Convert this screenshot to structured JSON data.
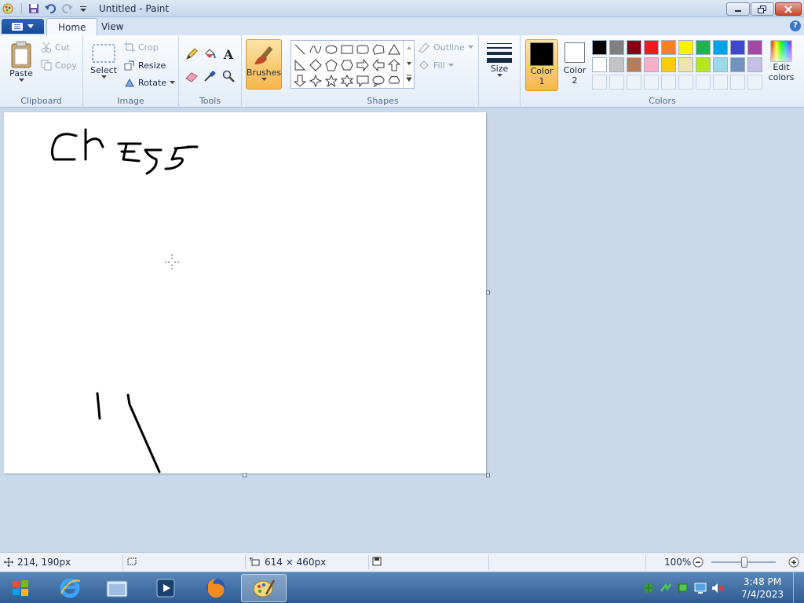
{
  "window": {
    "title": "Untitled - Paint"
  },
  "tabs": {
    "file_menu": "",
    "home": "Home",
    "view": "View"
  },
  "clipboard": {
    "paste": "Paste",
    "cut": "Cut",
    "copy": "Copy",
    "label": "Clipboard"
  },
  "image": {
    "select": "Select",
    "crop": "Crop",
    "resize": "Resize",
    "rotate": "Rotate",
    "label": "Image"
  },
  "tools": {
    "label": "Tools"
  },
  "brushes": {
    "label": "Brushes"
  },
  "shapes": {
    "outline": "Outline",
    "fill": "Fill",
    "label": "Shapes"
  },
  "size": {
    "label": "Size"
  },
  "colors": {
    "color1_label": "Color 1",
    "color1_value": "#000000",
    "color2_label": "Color 2",
    "color2_value": "#ffffff",
    "edit_label": "Edit colors",
    "label": "Colors",
    "palette_row1": [
      "#000000",
      "#7f7f7f",
      "#880015",
      "#ed1c24",
      "#ff7f27",
      "#fff200",
      "#22b14c",
      "#00a2e8",
      "#3f48cc",
      "#a349a4"
    ],
    "palette_row2": [
      "#ffffff",
      "#c3c3c3",
      "#b97a57",
      "#ffaec9",
      "#ffc90e",
      "#efe4b0",
      "#b5e61d",
      "#99d9ea",
      "#7092be",
      "#c8bfe7"
    ]
  },
  "canvas": {
    "drawn_text": "Chess"
  },
  "status": {
    "cursor_pos": "214, 190px",
    "canvas_size": "614 × 460px",
    "zoom": "100%"
  },
  "taskbar": {
    "time": "3:48 PM",
    "date": "7/4/2023"
  }
}
